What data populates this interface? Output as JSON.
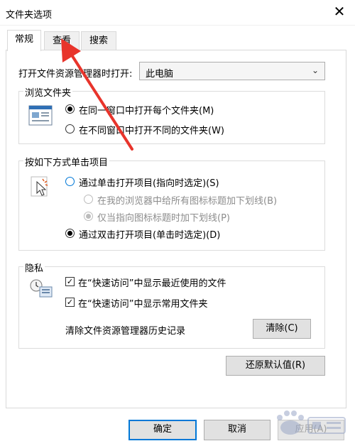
{
  "window": {
    "title": "文件夹选项",
    "close_glyph": "✕"
  },
  "tabs": [
    {
      "label": "常规",
      "active": true
    },
    {
      "label": "查看",
      "active": false
    },
    {
      "label": "搜索",
      "active": false
    }
  ],
  "open_explorer": {
    "label": "打开文件资源管理器时打开:",
    "value": "此电脑"
  },
  "browse": {
    "title": "浏览文件夹",
    "options": [
      {
        "label": "在同一窗口中打开每个文件夹(M)",
        "checked": true
      },
      {
        "label": "在不同窗口中打开不同的文件夹(W)",
        "checked": false
      }
    ]
  },
  "click": {
    "title": "按如下方式单击项目",
    "options": [
      {
        "label": "通过单击打开项目(指向时选定)(S)",
        "checked": false
      },
      {
        "label": "在我的浏览器中给所有图标标题加下划线(B)",
        "checked": false,
        "disabled": true
      },
      {
        "label": "仅当指向图标标题时加下划线(P)",
        "checked": true,
        "disabled": true
      },
      {
        "label": "通过双击打开项目(单击时选定)(D)",
        "checked": true
      }
    ]
  },
  "privacy": {
    "title": "隐私",
    "options": [
      {
        "label": "在“快速访问”中显示最近使用的文件",
        "checked": true
      },
      {
        "label": "在“快速访问”中显示常用文件夹",
        "checked": true
      }
    ],
    "clear_label": "清除文件资源管理器历史记录",
    "clear_button": "清除(C)"
  },
  "restore_button": "还原默认值(R)",
  "footer": {
    "ok": "确定",
    "cancel": "取消",
    "apply": "应用(A)"
  },
  "colors": {
    "accent": "#0078d7",
    "arrow": "#e8342b"
  },
  "icons": {
    "browse": "folder-window-icon",
    "click": "pointer-click-icon",
    "privacy": "clock-files-icon",
    "annotation": "red-arrow-annotation"
  }
}
